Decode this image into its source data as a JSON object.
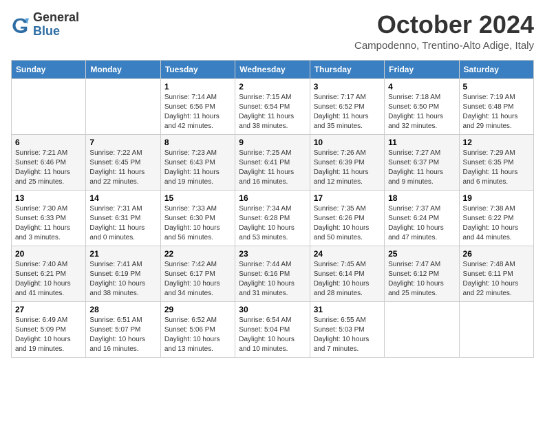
{
  "header": {
    "logo_general": "General",
    "logo_blue": "Blue",
    "month_title": "October 2024",
    "location": "Campodenno, Trentino-Alto Adige, Italy"
  },
  "weekdays": [
    "Sunday",
    "Monday",
    "Tuesday",
    "Wednesday",
    "Thursday",
    "Friday",
    "Saturday"
  ],
  "weeks": [
    [
      {
        "day": "",
        "info": ""
      },
      {
        "day": "",
        "info": ""
      },
      {
        "day": "1",
        "info": "Sunrise: 7:14 AM\nSunset: 6:56 PM\nDaylight: 11 hours and 42 minutes."
      },
      {
        "day": "2",
        "info": "Sunrise: 7:15 AM\nSunset: 6:54 PM\nDaylight: 11 hours and 38 minutes."
      },
      {
        "day": "3",
        "info": "Sunrise: 7:17 AM\nSunset: 6:52 PM\nDaylight: 11 hours and 35 minutes."
      },
      {
        "day": "4",
        "info": "Sunrise: 7:18 AM\nSunset: 6:50 PM\nDaylight: 11 hours and 32 minutes."
      },
      {
        "day": "5",
        "info": "Sunrise: 7:19 AM\nSunset: 6:48 PM\nDaylight: 11 hours and 29 minutes."
      }
    ],
    [
      {
        "day": "6",
        "info": "Sunrise: 7:21 AM\nSunset: 6:46 PM\nDaylight: 11 hours and 25 minutes."
      },
      {
        "day": "7",
        "info": "Sunrise: 7:22 AM\nSunset: 6:45 PM\nDaylight: 11 hours and 22 minutes."
      },
      {
        "day": "8",
        "info": "Sunrise: 7:23 AM\nSunset: 6:43 PM\nDaylight: 11 hours and 19 minutes."
      },
      {
        "day": "9",
        "info": "Sunrise: 7:25 AM\nSunset: 6:41 PM\nDaylight: 11 hours and 16 minutes."
      },
      {
        "day": "10",
        "info": "Sunrise: 7:26 AM\nSunset: 6:39 PM\nDaylight: 11 hours and 12 minutes."
      },
      {
        "day": "11",
        "info": "Sunrise: 7:27 AM\nSunset: 6:37 PM\nDaylight: 11 hours and 9 minutes."
      },
      {
        "day": "12",
        "info": "Sunrise: 7:29 AM\nSunset: 6:35 PM\nDaylight: 11 hours and 6 minutes."
      }
    ],
    [
      {
        "day": "13",
        "info": "Sunrise: 7:30 AM\nSunset: 6:33 PM\nDaylight: 11 hours and 3 minutes."
      },
      {
        "day": "14",
        "info": "Sunrise: 7:31 AM\nSunset: 6:31 PM\nDaylight: 11 hours and 0 minutes."
      },
      {
        "day": "15",
        "info": "Sunrise: 7:33 AM\nSunset: 6:30 PM\nDaylight: 10 hours and 56 minutes."
      },
      {
        "day": "16",
        "info": "Sunrise: 7:34 AM\nSunset: 6:28 PM\nDaylight: 10 hours and 53 minutes."
      },
      {
        "day": "17",
        "info": "Sunrise: 7:35 AM\nSunset: 6:26 PM\nDaylight: 10 hours and 50 minutes."
      },
      {
        "day": "18",
        "info": "Sunrise: 7:37 AM\nSunset: 6:24 PM\nDaylight: 10 hours and 47 minutes."
      },
      {
        "day": "19",
        "info": "Sunrise: 7:38 AM\nSunset: 6:22 PM\nDaylight: 10 hours and 44 minutes."
      }
    ],
    [
      {
        "day": "20",
        "info": "Sunrise: 7:40 AM\nSunset: 6:21 PM\nDaylight: 10 hours and 41 minutes."
      },
      {
        "day": "21",
        "info": "Sunrise: 7:41 AM\nSunset: 6:19 PM\nDaylight: 10 hours and 38 minutes."
      },
      {
        "day": "22",
        "info": "Sunrise: 7:42 AM\nSunset: 6:17 PM\nDaylight: 10 hours and 34 minutes."
      },
      {
        "day": "23",
        "info": "Sunrise: 7:44 AM\nSunset: 6:16 PM\nDaylight: 10 hours and 31 minutes."
      },
      {
        "day": "24",
        "info": "Sunrise: 7:45 AM\nSunset: 6:14 PM\nDaylight: 10 hours and 28 minutes."
      },
      {
        "day": "25",
        "info": "Sunrise: 7:47 AM\nSunset: 6:12 PM\nDaylight: 10 hours and 25 minutes."
      },
      {
        "day": "26",
        "info": "Sunrise: 7:48 AM\nSunset: 6:11 PM\nDaylight: 10 hours and 22 minutes."
      }
    ],
    [
      {
        "day": "27",
        "info": "Sunrise: 6:49 AM\nSunset: 5:09 PM\nDaylight: 10 hours and 19 minutes."
      },
      {
        "day": "28",
        "info": "Sunrise: 6:51 AM\nSunset: 5:07 PM\nDaylight: 10 hours and 16 minutes."
      },
      {
        "day": "29",
        "info": "Sunrise: 6:52 AM\nSunset: 5:06 PM\nDaylight: 10 hours and 13 minutes."
      },
      {
        "day": "30",
        "info": "Sunrise: 6:54 AM\nSunset: 5:04 PM\nDaylight: 10 hours and 10 minutes."
      },
      {
        "day": "31",
        "info": "Sunrise: 6:55 AM\nSunset: 5:03 PM\nDaylight: 10 hours and 7 minutes."
      },
      {
        "day": "",
        "info": ""
      },
      {
        "day": "",
        "info": ""
      }
    ]
  ]
}
